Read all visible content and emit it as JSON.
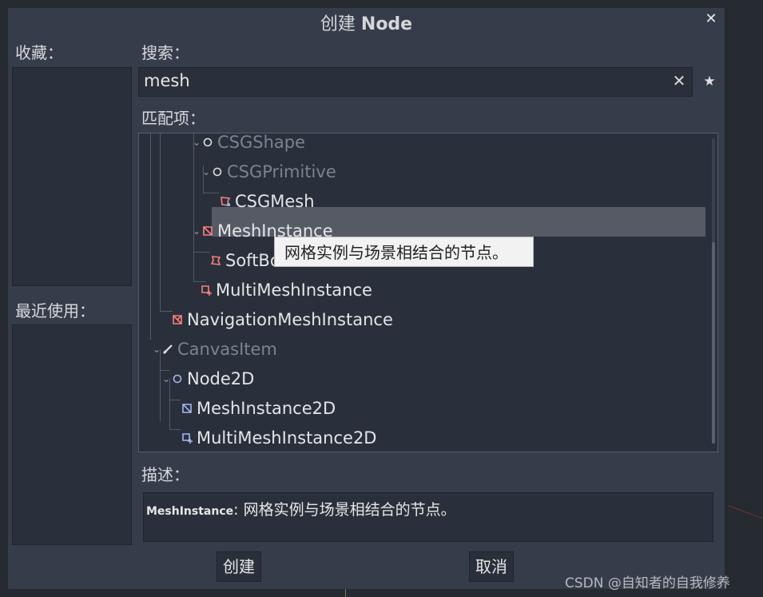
{
  "dialog": {
    "title_prefix": "创建",
    "title_bold": "Node",
    "close_symbol": "✕"
  },
  "favorites": {
    "label": "收藏："
  },
  "recent": {
    "label": "最近使用："
  },
  "search": {
    "label": "搜索：",
    "value": "mesh",
    "clear_symbol": "✕",
    "favorite_symbol": "★"
  },
  "matches": {
    "label": "匹配项：",
    "items": [
      {
        "label": "CSGShape",
        "dim": true
      },
      {
        "label": "CSGPrimitive",
        "dim": true
      },
      {
        "label": "CSGMesh",
        "dim": false
      },
      {
        "label": "MeshInstance",
        "dim": false,
        "selected": true
      },
      {
        "label": "SoftBo",
        "dim": false
      },
      {
        "label": "MultiMeshInstance",
        "dim": false
      },
      {
        "label": "NavigationMeshInstance",
        "dim": false
      },
      {
        "label": "CanvasItem",
        "dim": true
      },
      {
        "label": "Node2D",
        "dim": false
      },
      {
        "label": "MeshInstance2D",
        "dim": false
      },
      {
        "label": "MultiMeshInstance2D",
        "dim": false
      }
    ],
    "tooltip": "网格实例与场景相结合的节点。"
  },
  "description": {
    "label": "描述：",
    "class_name": "MeshInstance",
    "text": ": 网格实例与场景相结合的节点。"
  },
  "buttons": {
    "create": "创建",
    "cancel": "取消"
  },
  "watermark": "CSDN @自知者的自我修养",
  "colors": {
    "dialog_bg": "#363d4a",
    "panel_bg": "#2a303b",
    "selected_row": "#555a64",
    "icon_3d": "#fc7f7f",
    "icon_2d": "#a5b7f3"
  }
}
